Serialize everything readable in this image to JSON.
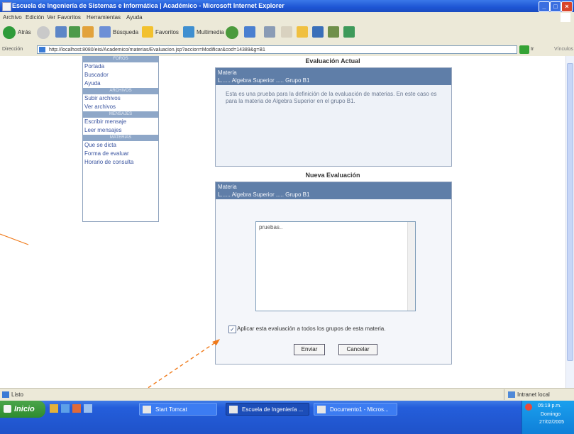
{
  "window": {
    "title": "Escuela de Ingeniería de Sistemas e Informática | Académico - Microsoft Internet Explorer",
    "minimize": "_",
    "maximize": "□",
    "close": "×"
  },
  "menubar": [
    "Archivo",
    "Edición",
    "Ver",
    "Favoritos",
    "Herramientas",
    "Ayuda"
  ],
  "toolbar": {
    "back": "Atrás",
    "search": "Búsqueda",
    "favorites": "Favoritos",
    "multimedia": "Multimedia"
  },
  "address": {
    "label": "Dirección",
    "value": "http://localhost:8080/eisi/Academico/materias/Evaluacion.jsp?accion=Modificar&cod=14389&g=B1",
    "go": "Ir",
    "links": "Vínculos"
  },
  "sidebar": {
    "sections": [
      {
        "header": "FOROS",
        "items": [
          "Portada",
          "Buscador",
          "Ayuda"
        ]
      },
      {
        "header": "ARCHIVOS",
        "items": [
          "Subir archivos",
          "Ver archivos"
        ]
      },
      {
        "header": "MENSAJES",
        "items": [
          "Escribir mensaje",
          "Leer mensajes"
        ]
      },
      {
        "header": "MATERIAS",
        "items": [
          "Que se dicta",
          "Forma de evaluar",
          "Horario de consulta"
        ]
      }
    ]
  },
  "current_eval": {
    "title": "Evaluación Actual",
    "materia_label": "Materia",
    "materia_value": "L...... Algebra Superior ..... Grupo B1",
    "description": "Esta es una prueba para la definición de la evaluación de materias. En este caso es para la materia de Algebra Superior en el grupo B1."
  },
  "new_eval": {
    "title": "Nueva Evaluación",
    "materia_label": "Materia",
    "materia_value": "L...... Algebra Superior ..... Grupo B1",
    "textarea_value": "pruebas..",
    "checkbox_checked": true,
    "checkbox_mark": "✓",
    "checkbox_label": "Aplicar esta evaluación a todos los grupos de esta materia.",
    "submit_label": "Enviar",
    "cancel_label": "Cancelar"
  },
  "status": {
    "left": "Listo",
    "zone": "Intranet local"
  },
  "taskbar": {
    "start": "Inicio",
    "tasks": [
      {
        "label": "Start Tomcat",
        "active": false
      },
      {
        "label": "Escuela de Ingeniería ...",
        "active": true
      },
      {
        "label": "Documento1 - Micros...",
        "active": false
      }
    ],
    "time": "05:19 p.m.",
    "day": "Domingo",
    "date": "27/02/2005"
  },
  "colors": {
    "panel_header": "#5f7ea8",
    "panel_body": "#eef2f8",
    "sidebar_header": "#8ea7c8",
    "link": "#3b55a0",
    "annotation_arrow": "#f07a1a"
  }
}
